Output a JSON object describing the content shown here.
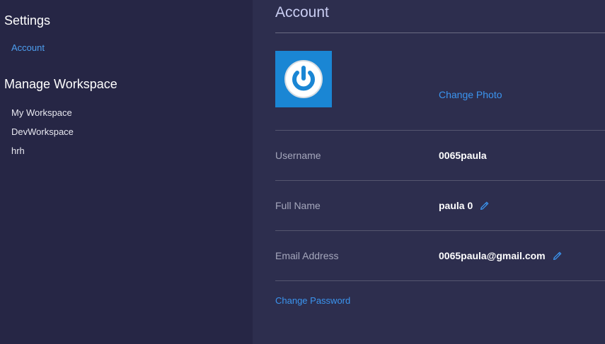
{
  "sidebar": {
    "settings_title": "Settings",
    "settings_items": [
      {
        "label": "Account"
      }
    ],
    "workspace_title": "Manage Workspace",
    "workspace_items": [
      {
        "label": "My Workspace"
      },
      {
        "label": "DevWorkspace"
      },
      {
        "label": "hrh"
      }
    ]
  },
  "main": {
    "title": "Account",
    "change_photo_label": "Change Photo",
    "username": {
      "label": "Username",
      "value": "0065paula"
    },
    "full_name": {
      "label": "Full Name",
      "value": "paula 0",
      "edit_icon": "pencil-icon"
    },
    "email": {
      "label": "Email Address",
      "value": "0065paula@gmail.com",
      "edit_icon": "pencil-icon"
    },
    "change_password_label": "Change Password",
    "avatar_icon": "power-icon"
  },
  "colors": {
    "sidebar_bg": "#262645",
    "main_bg": "#2d2e4e",
    "accent": "#3b95f0",
    "avatar_bg": "#1a86d4",
    "title": "#c9cdf2"
  }
}
